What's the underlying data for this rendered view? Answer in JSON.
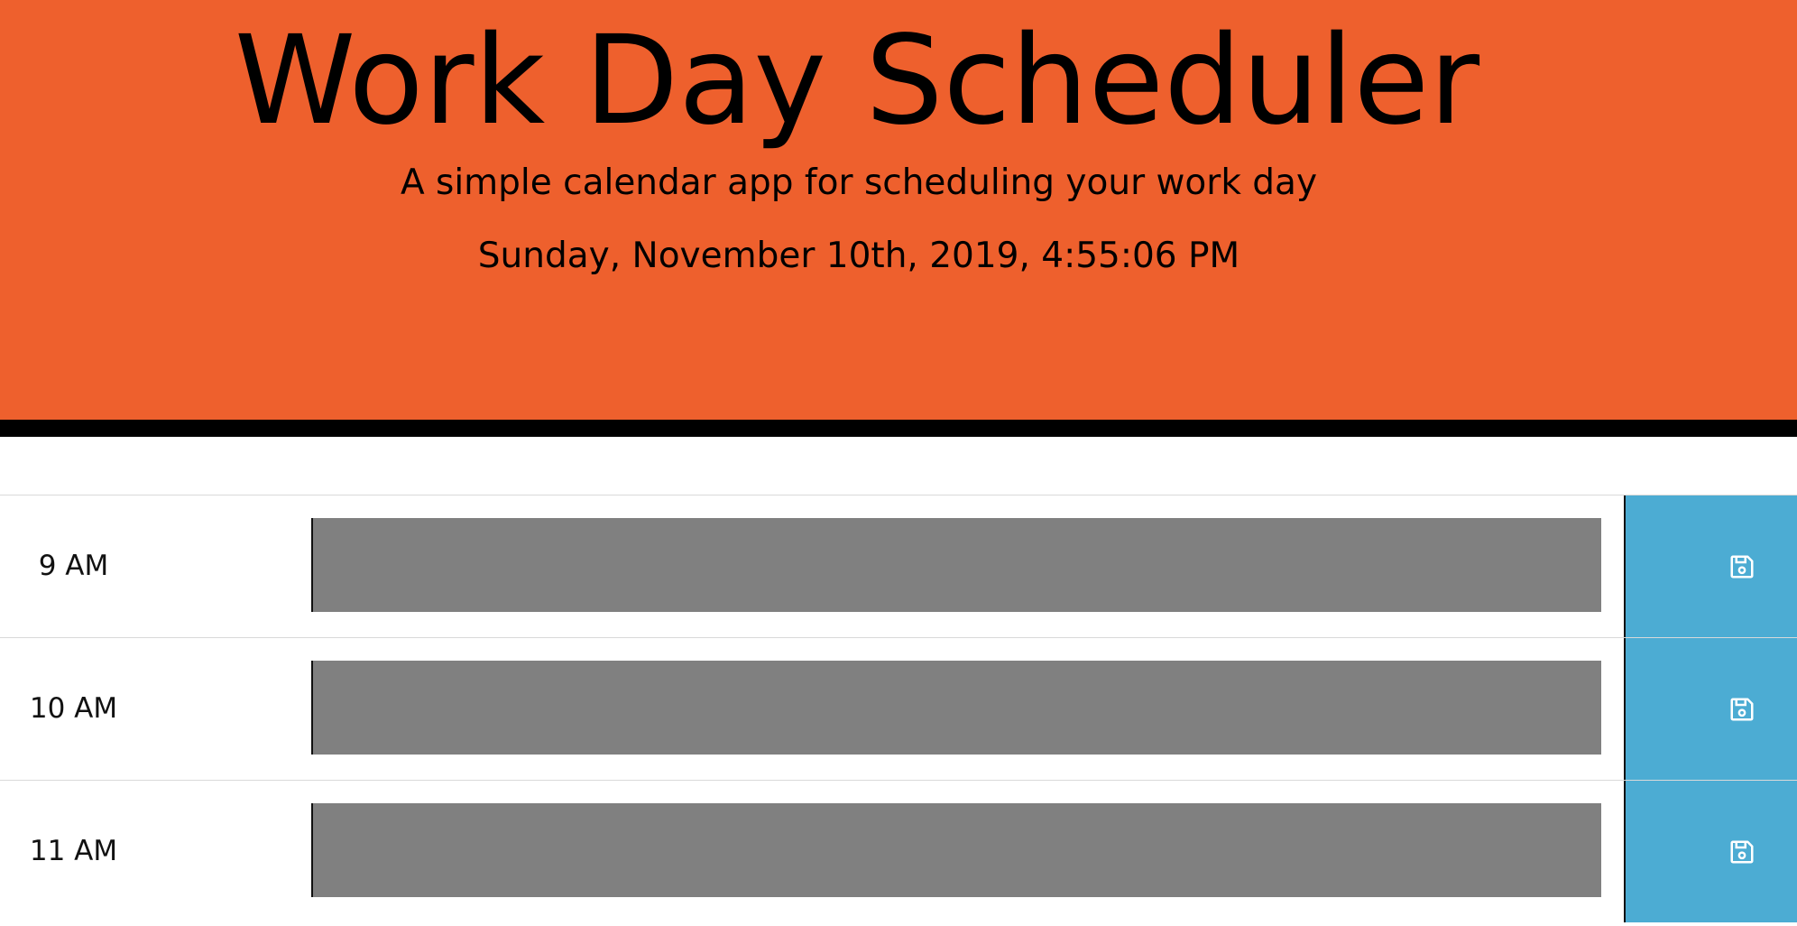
{
  "header": {
    "title": "Work Day Scheduler",
    "lead": "A simple calendar app for scheduling your work day",
    "current_day": "Sunday, November 10th, 2019, 4:55:06 PM"
  },
  "colors": {
    "header_bg": "#ee602d",
    "past_block": "#808080",
    "save_button": "#4cacd3"
  },
  "time_blocks": [
    {
      "hour": "9 AM",
      "description": "",
      "state": "past",
      "save_icon": "floppy-disk-icon"
    },
    {
      "hour": "10 AM",
      "description": "",
      "state": "past",
      "save_icon": "floppy-disk-icon"
    },
    {
      "hour": "11 AM",
      "description": "",
      "state": "past",
      "save_icon": "floppy-disk-icon"
    }
  ]
}
